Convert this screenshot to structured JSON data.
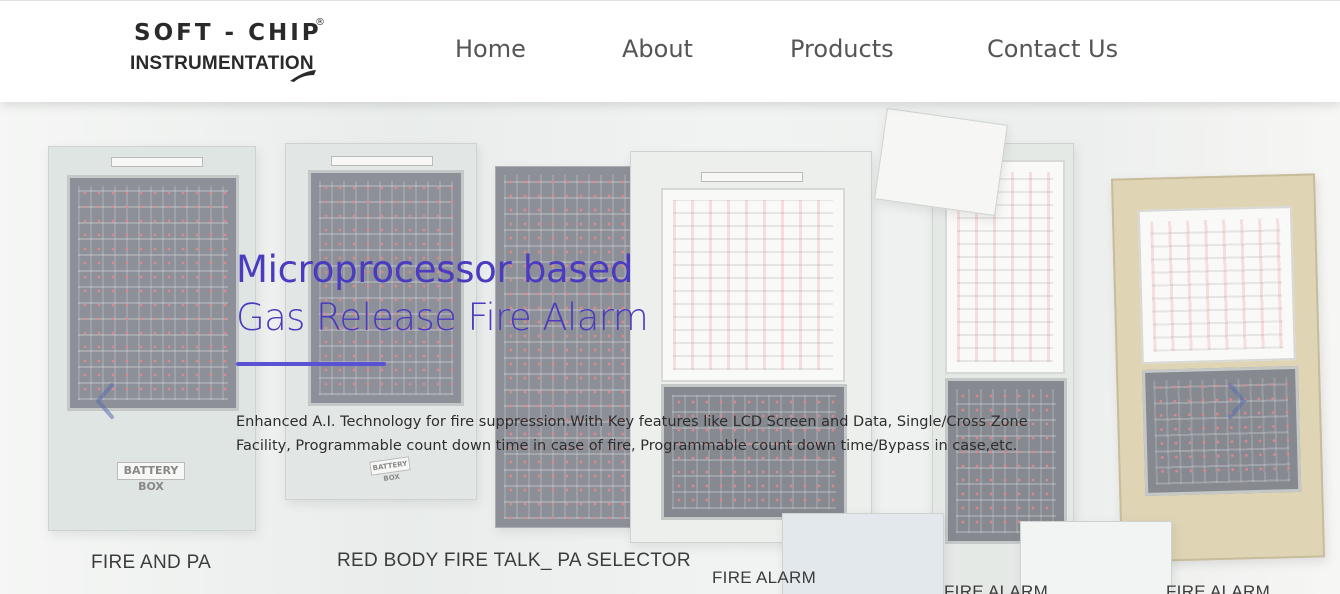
{
  "header": {
    "logo": {
      "line1": "SOFT - CHIP",
      "registered": "®",
      "line2": "INSTRUMENTATION"
    },
    "nav": [
      {
        "label": "Home"
      },
      {
        "label": "About"
      },
      {
        "label": "Products"
      },
      {
        "label": "Contact Us"
      }
    ]
  },
  "hero": {
    "title_line1": "Microprocessor based",
    "title_line2": "Gas Release Fire Alarm",
    "description": "Enhanced A.I. Technology for fire suppression.With Key features like LCD Screen and Data, Single/Cross Zone Facility, Programmable count down time in case of fire, Programmable count down time/Bypass in case,etc.",
    "product_labels": [
      "FIRE AND PA",
      "RED BODY FIRE TALK_ PA SELECTOR",
      "FIRE ALARM",
      "FIRE ALARM",
      "FIRE ALARM"
    ],
    "battery_label": "BATTERY BOX",
    "colors": {
      "accent": "#4b3bc0",
      "rule": "#5a52d5",
      "arrow": "#5a6fb0"
    }
  },
  "icons": {
    "prev": "chevron-left-icon",
    "next": "chevron-right-icon"
  }
}
